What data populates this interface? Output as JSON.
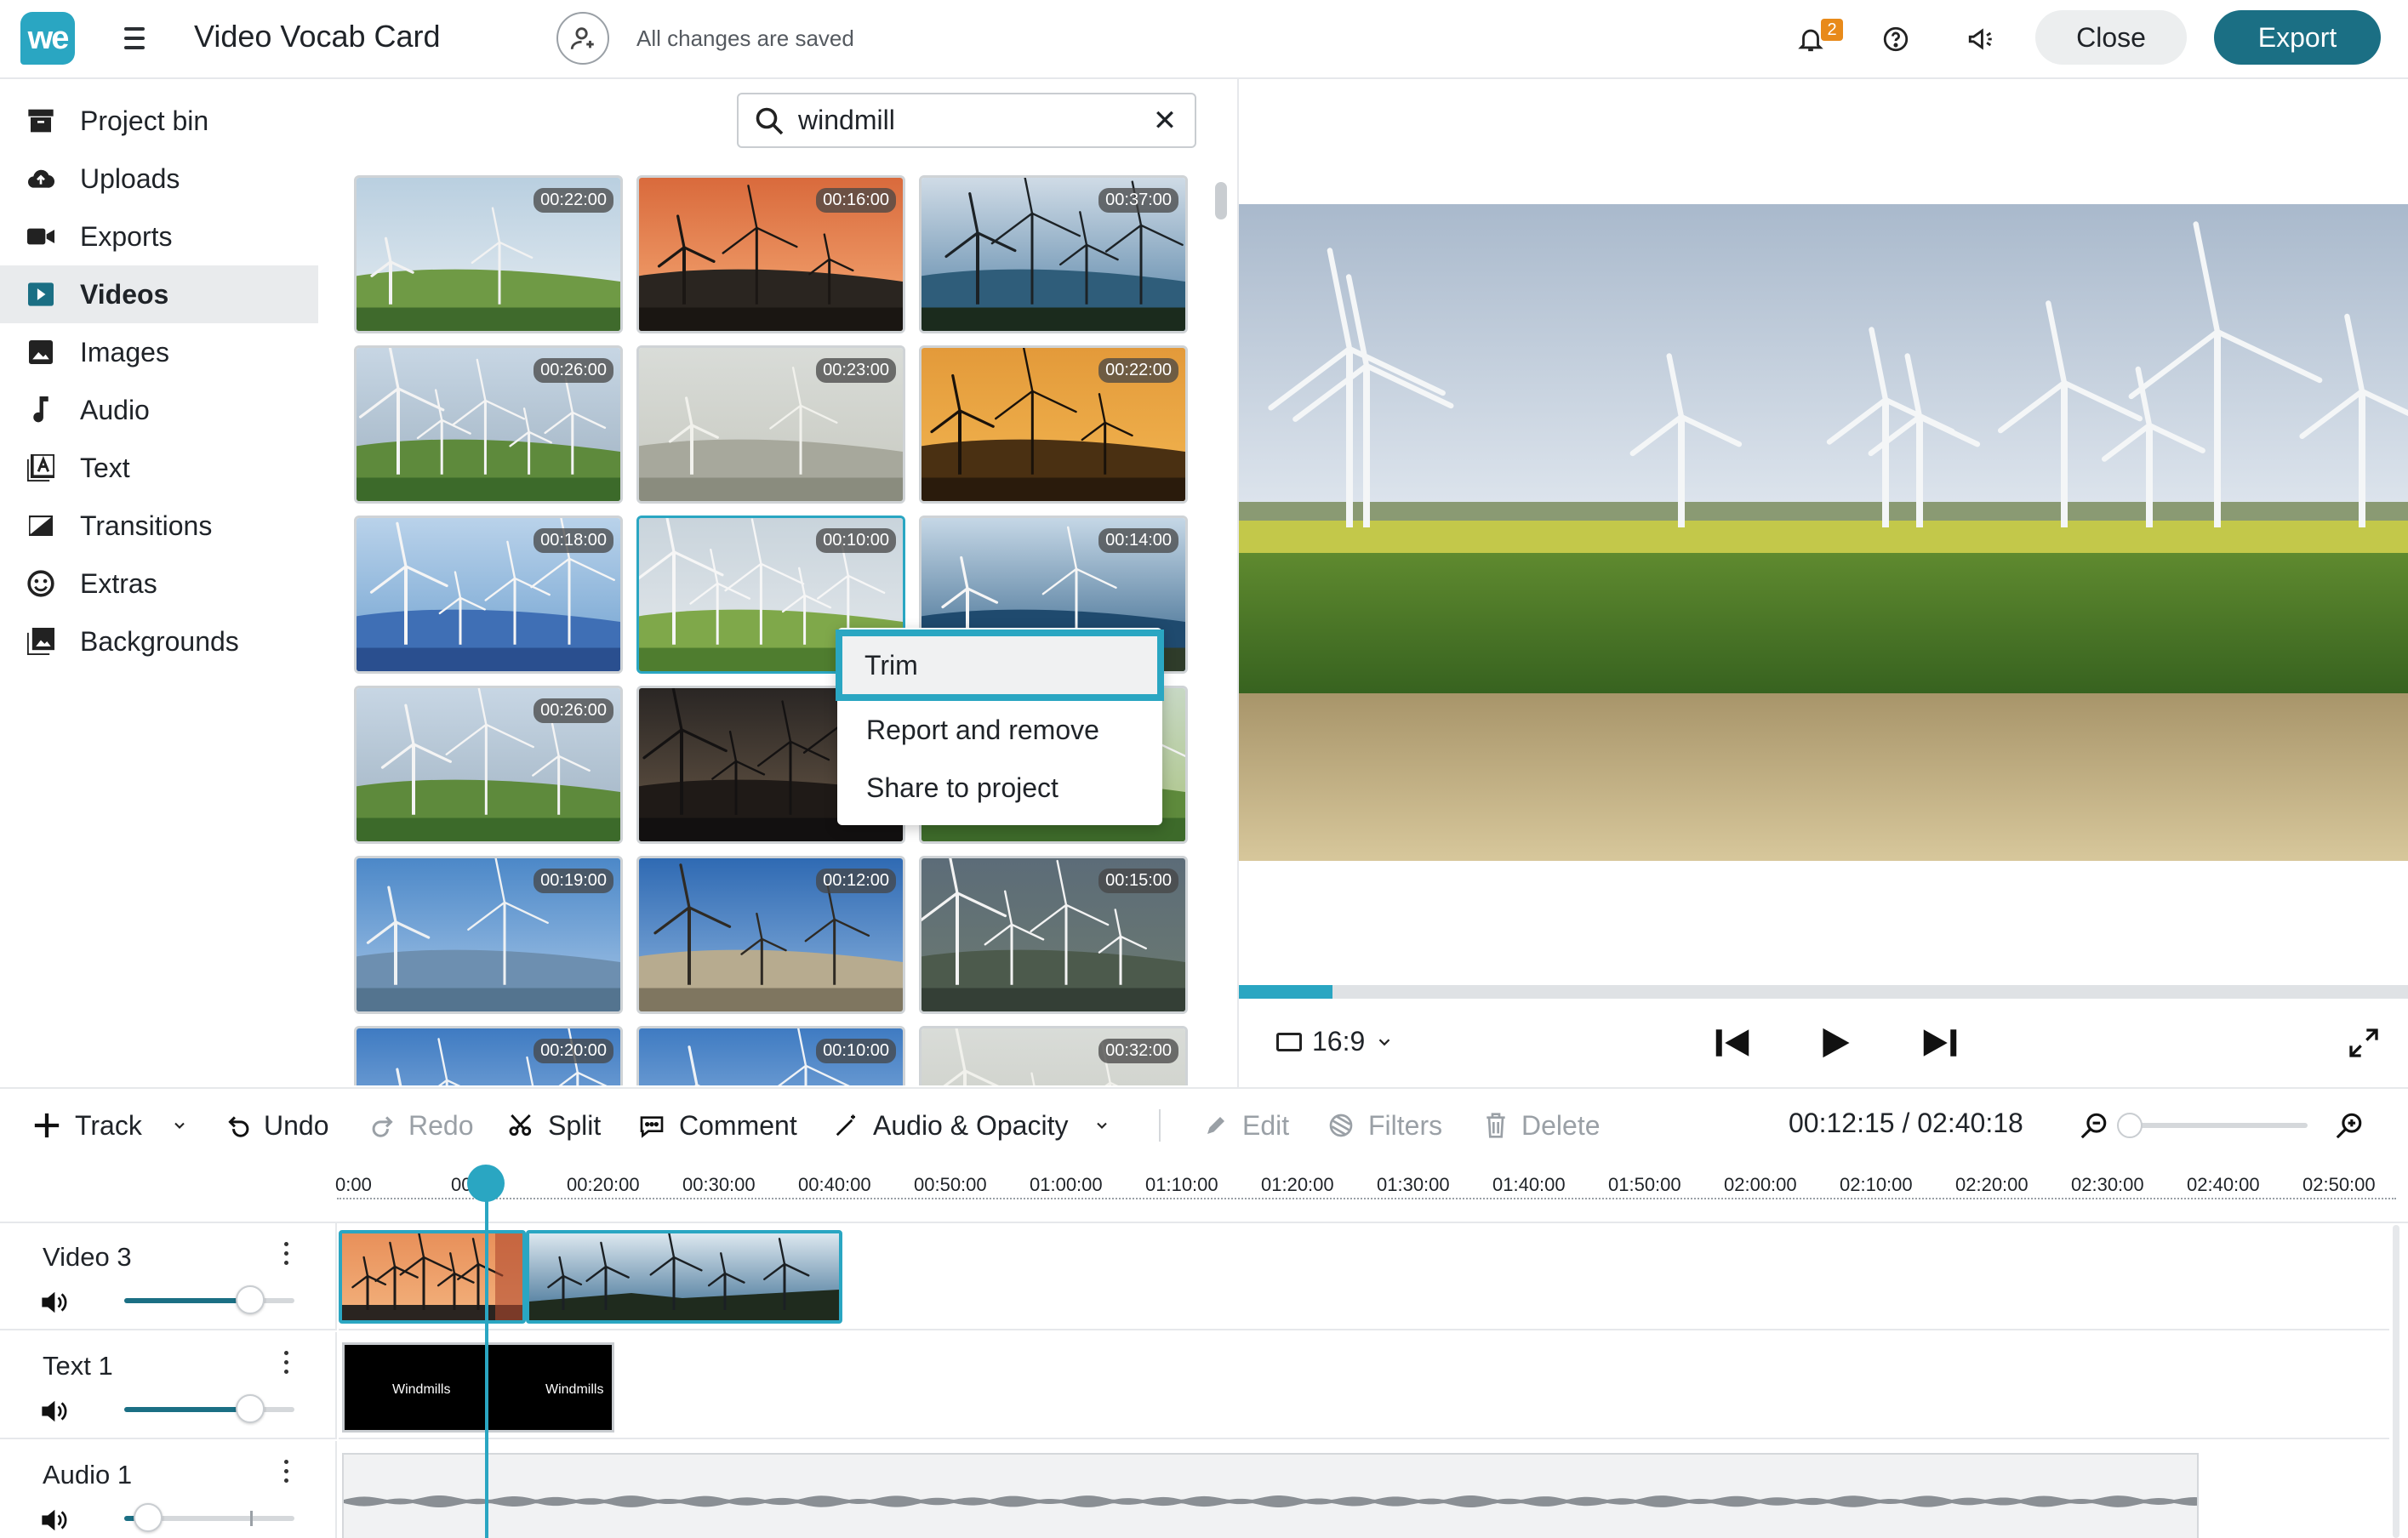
{
  "app": {
    "logo": "we",
    "title": "Video Vocab Card",
    "save_status": "All changes are saved",
    "notification_count": "2",
    "close_label": "Close",
    "export_label": "Export",
    "accent": "#2aa6c2",
    "brand": "#1b6f84"
  },
  "sidebar": {
    "items": [
      {
        "label": "Project bin",
        "icon": "archive-icon"
      },
      {
        "label": "Uploads",
        "icon": "cloud-upload-icon"
      },
      {
        "label": "Exports",
        "icon": "video-camera-icon"
      },
      {
        "label": "Videos",
        "icon": "play-square-icon",
        "active": true
      },
      {
        "label": "Images",
        "icon": "image-icon"
      },
      {
        "label": "Audio",
        "icon": "music-note-icon"
      },
      {
        "label": "Text",
        "icon": "text-icon"
      },
      {
        "label": "Transitions",
        "icon": "transition-icon"
      },
      {
        "label": "Extras",
        "icon": "smiley-icon"
      },
      {
        "label": "Backgrounds",
        "icon": "backgrounds-icon"
      }
    ]
  },
  "search": {
    "value": "windmill",
    "placeholder": "Search"
  },
  "media": {
    "thumbs": [
      {
        "duration": "00:22:00",
        "scene": "green-farm"
      },
      {
        "duration": "00:16:00",
        "scene": "orange-sunset"
      },
      {
        "duration": "00:37:00",
        "scene": "coast-blue"
      },
      {
        "duration": "00:26:00",
        "scene": "mountain"
      },
      {
        "duration": "00:23:00",
        "scene": "grey-close"
      },
      {
        "duration": "00:22:00",
        "scene": "orange-mill"
      },
      {
        "duration": "00:18:00",
        "scene": "solar"
      },
      {
        "duration": "00:10:00",
        "scene": "field",
        "selected": true
      },
      {
        "duration": "00:14:00",
        "scene": "sea"
      },
      {
        "duration": "00:26:00",
        "scene": "mountain"
      },
      {
        "duration": "",
        "scene": "dusk"
      },
      {
        "duration": "",
        "scene": "green-field"
      },
      {
        "duration": "00:19:00",
        "scene": "sky-turbine"
      },
      {
        "duration": "00:12:00",
        "scene": "reed-mill"
      },
      {
        "duration": "00:15:00",
        "scene": "aerial"
      },
      {
        "duration": "00:20:00",
        "scene": "sky"
      },
      {
        "duration": "00:10:00",
        "scene": "sky"
      },
      {
        "duration": "00:32:00",
        "scene": "grey-close"
      }
    ]
  },
  "context_menu": {
    "items": [
      "Trim",
      "Report and remove",
      "Share to project"
    ]
  },
  "player": {
    "aspect_ratio": "16:9",
    "progress": 0.08
  },
  "toolbar": {
    "track": "Track",
    "undo": "Undo",
    "redo": "Redo",
    "split": "Split",
    "comment": "Comment",
    "audio_opacity": "Audio & Opacity",
    "edit": "Edit",
    "filters": "Filters",
    "delete": "Delete",
    "timecode": "00:12:15 / 02:40:18",
    "zoom_level": 0.0
  },
  "ruler": {
    "ticks": [
      "0:00",
      "00:10:",
      "00:20:00",
      "00:30:00",
      "00:40:00",
      "00:50:00",
      "01:00:00",
      "01:10:00",
      "01:20:00",
      "01:30:00",
      "01:40:00",
      "01:50:00",
      "02:00:00",
      "02:10:00",
      "02:20:00",
      "02:30:00",
      "02:40:00",
      "02:50:00"
    ]
  },
  "tracks": [
    {
      "name": "Video 3",
      "volume": 0.74
    },
    {
      "name": "Text 1",
      "volume": 0.74
    },
    {
      "name": "Audio 1",
      "volume": 0.14
    }
  ],
  "text_clip": {
    "label_a": "Windmills",
    "label_b": "Windmills"
  }
}
